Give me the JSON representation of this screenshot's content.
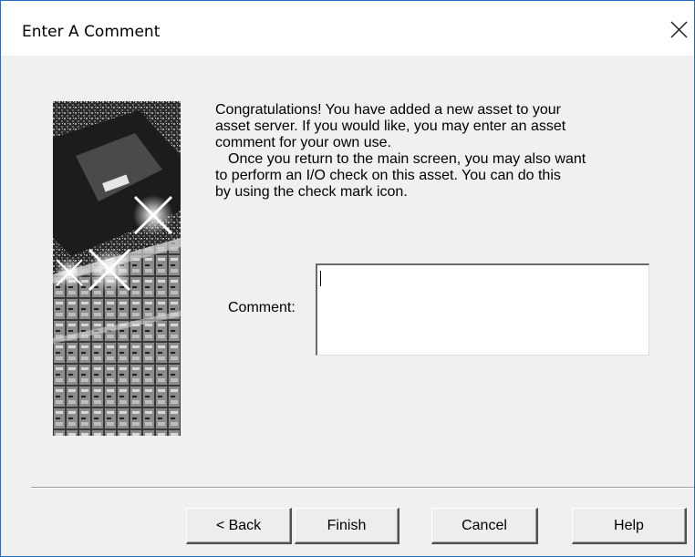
{
  "window": {
    "title": "Enter A Comment"
  },
  "message": {
    "paragraph1": "Congratulations!  You have added a new asset to your\nasset server.  If you would like, you may enter an asset\ncomment for your own use.",
    "paragraph2": "Once you return to the main screen, you may also want\nto perform an I/O check on this asset.  You can do this\nby using the check mark icon."
  },
  "comment": {
    "label": "Comment:",
    "value": ""
  },
  "buttons": {
    "back": "< Back",
    "finish": "Finish",
    "cancel": "Cancel",
    "help": "Help"
  },
  "icons": {
    "close": "close-icon"
  },
  "colors": {
    "window_border": "#1f6fc6",
    "dialog_background": "#f0f0f0",
    "titlebar_background": "#ffffff"
  }
}
